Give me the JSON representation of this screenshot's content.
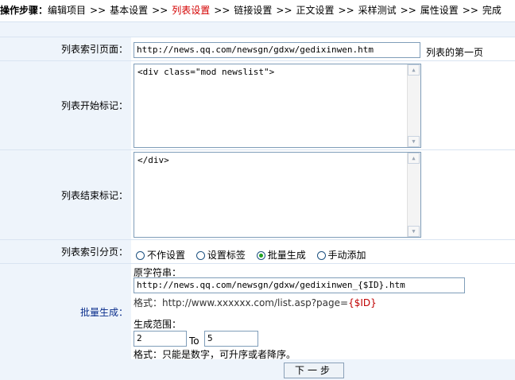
{
  "steps": {
    "lead": "操作步骤：",
    "items": [
      "编辑项目",
      "基本设置",
      "列表设置",
      "链接设置",
      "正文设置",
      "采样测试",
      "属性设置",
      "完成"
    ],
    "separator": ">>",
    "current_index": 2,
    "current_color": "#d40000"
  },
  "form": {
    "index_page": {
      "label": "列表索引页面：",
      "value": "http://news.qq.com/newsgn/gdxw/gedixinwen.htm",
      "hint": "列表的第一页"
    },
    "start_tag": {
      "label": "列表开始标记：",
      "value": "<div class=\"mod newslist\">"
    },
    "end_tag": {
      "label": "列表结束标记：",
      "value": "</div>"
    },
    "paging": {
      "label": "列表索引分页：",
      "options": [
        "不作设置",
        "设置标签",
        "批量生成",
        "手动添加"
      ],
      "selected_index": 2
    },
    "batch": {
      "label": "批量生成：",
      "src_label": "原字符串：",
      "src_value": "http://news.qq.com/newsgn/gdxw/gedixinwen_{$ID}.htm",
      "format_prefix": "格式：",
      "format_example": "http://www.xxxxxx.com/list.asp?page=",
      "format_token": "{$ID}",
      "range_label": "生成范围：",
      "range_from": "2",
      "range_to_label": "To",
      "range_to": "5",
      "range_note": "格式：只能是数字，可升序或者降序。"
    }
  },
  "next_button": "下一步",
  "colors": {
    "label_bg": "#eef4fb",
    "label_blue": "#0a2e8c",
    "border": "#7f9db9",
    "radio_dot": "#21a121"
  }
}
